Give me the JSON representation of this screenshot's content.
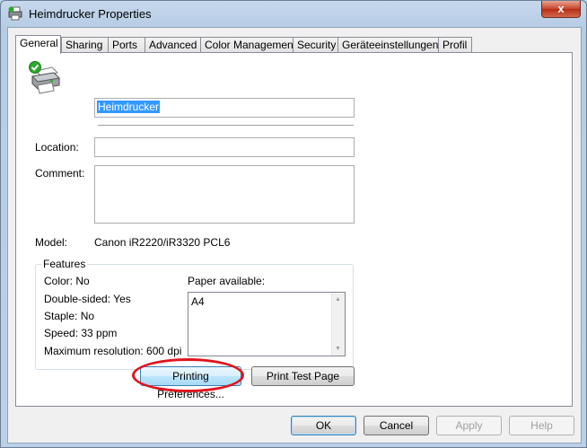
{
  "window": {
    "title": "Heimdrucker Properties",
    "close_glyph": "x"
  },
  "tabs": [
    "General",
    "Sharing",
    "Ports",
    "Advanced",
    "Color Management",
    "Security",
    "Geräteeinstellungen",
    "Profil"
  ],
  "general": {
    "printer_name": "Heimdrucker",
    "location_label": "Location:",
    "location_value": "",
    "comment_label": "Comment:",
    "comment_value": "",
    "model_label": "Model:",
    "model_value": "Canon iR2220/iR3320 PCL6",
    "features": {
      "title": "Features",
      "color": "Color: No",
      "double_sided": "Double-sided: Yes",
      "staple": "Staple: No",
      "speed": "Speed: 33 ppm",
      "max_resolution": "Maximum resolution: 600 dpi",
      "paper_label": "Paper available:",
      "paper_items": [
        "A4"
      ]
    },
    "printing_preferences_label": "Printing Preferences...",
    "print_test_page_label": "Print Test Page"
  },
  "footer": {
    "ok": "OK",
    "cancel": "Cancel",
    "apply": "Apply",
    "help": "Help"
  },
  "icons": {
    "printer": "printer-icon",
    "check": "check-icon"
  },
  "colors": {
    "highlight_ellipse": "#e0141e",
    "selection": "#3399ff"
  }
}
